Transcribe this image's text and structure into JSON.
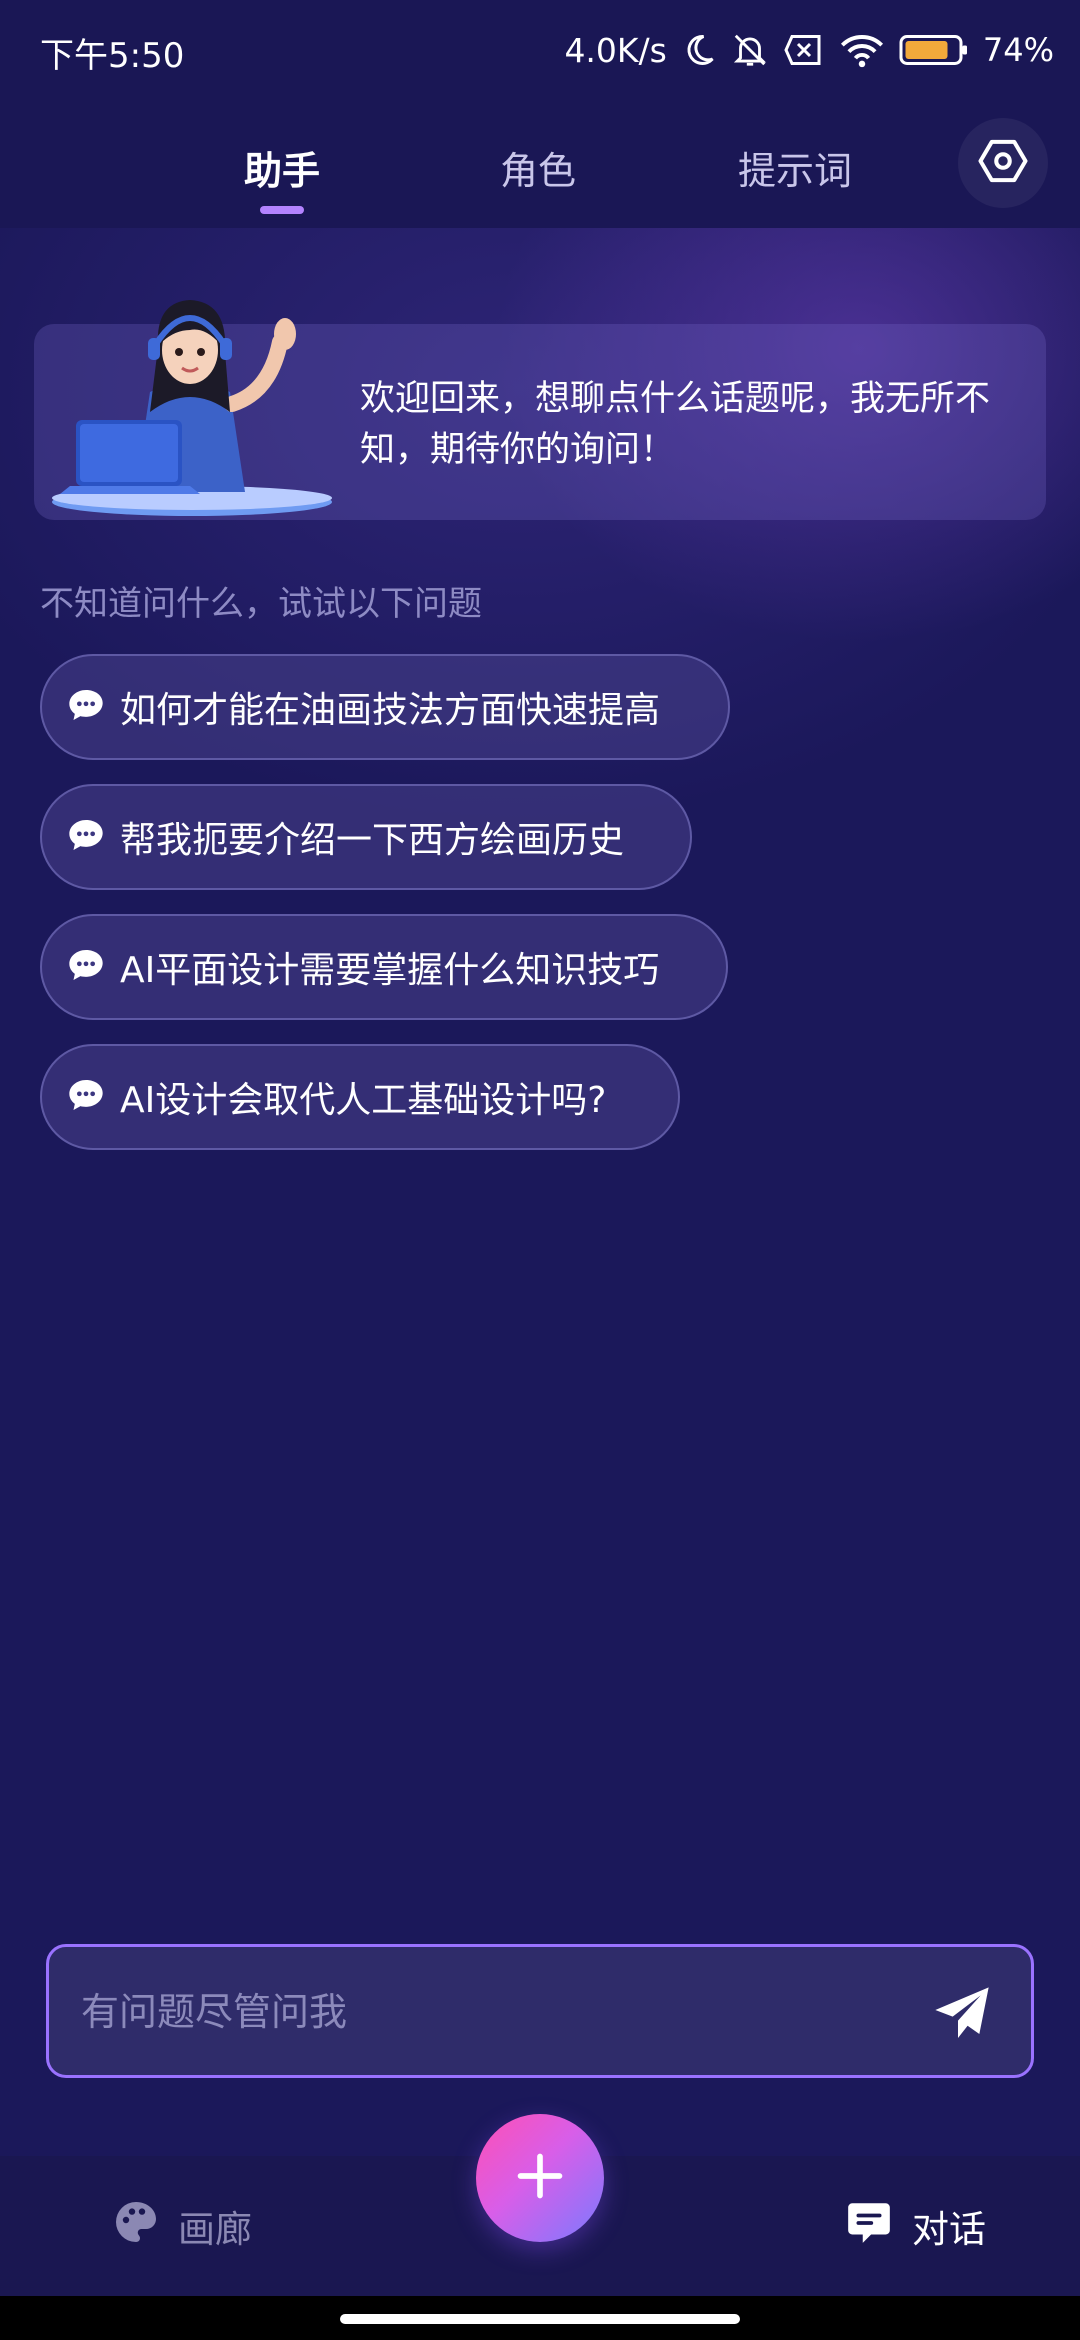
{
  "status_bar": {
    "time": "下午5:50",
    "network_speed": "4.0K/s",
    "battery": "74%",
    "battery_level": 0.74,
    "icons": [
      "moon-icon",
      "mute-icon",
      "sim-x-icon",
      "wifi-icon",
      "battery-icon"
    ]
  },
  "top_tabs": {
    "items": [
      {
        "label": "助手",
        "active": true
      },
      {
        "label": "角色",
        "active": false
      },
      {
        "label": "提示词",
        "active": false
      }
    ],
    "settings_icon": "hexagon-gear-icon"
  },
  "welcome": {
    "text": "欢迎回来，想聊点什么话题呢，我无所不知，期待你的询问！"
  },
  "hint": "不知道问什么，试试以下问题",
  "suggestions": [
    "如何才能在油画技法方面快速提高",
    "帮我扼要介绍一下西方绘画历史",
    "AI平面设计需要掌握什么知识技巧",
    "AI设计会取代人工基础设计吗?"
  ],
  "input": {
    "placeholder": "有问题尽管问我",
    "value": ""
  },
  "bottom_nav": {
    "gallery_label": "画廊",
    "chat_label": "对话",
    "fab_icon": "plus-icon"
  },
  "colors": {
    "background": "#1b185a",
    "accent": "#9a72ff",
    "fab_gradient_start": "#ff4fb4",
    "fab_gradient_end": "#7a7aff"
  }
}
